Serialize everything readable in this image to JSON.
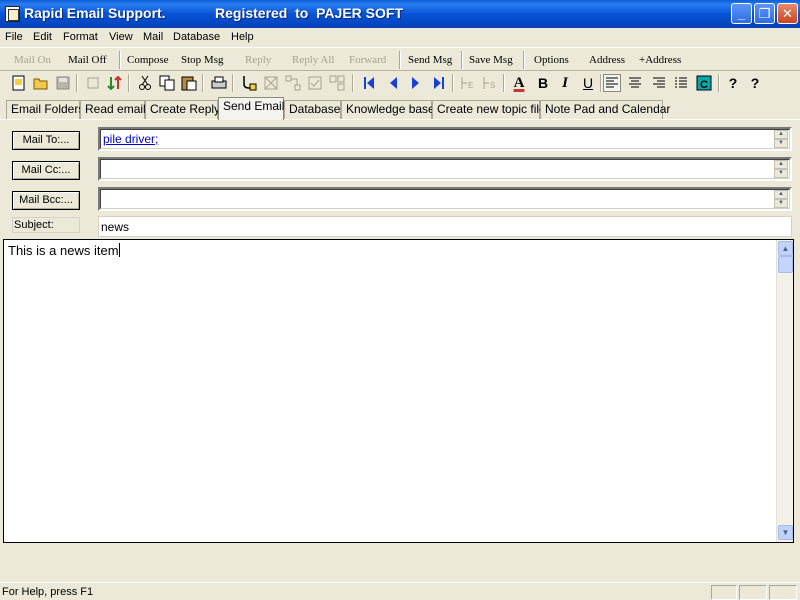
{
  "window": {
    "title": "Rapid Email Support.",
    "registration": "Registered  to  PAJER SOFT",
    "minimize": "_",
    "maximize": "❐",
    "close": "✕"
  },
  "menu": [
    "File",
    "Edit",
    "Format",
    "View",
    "Mail",
    "Database",
    "Help"
  ],
  "text_toolbar": {
    "mail_on": "Mail On",
    "mail_off": "Mail Off",
    "compose": "Compose",
    "stop_msg": "Stop Msg",
    "reply": "Reply",
    "reply_all": "Reply All",
    "forward": "Forward",
    "send_msg": "Send Msg",
    "save_msg": "Save Msg",
    "options": "Options",
    "address": "Address",
    "add_address": "+Address"
  },
  "icon_toolbar": {
    "bold": "B",
    "italic": "I",
    "underline": "U",
    "font_color": "A",
    "help": "?",
    "whats_this": "?"
  },
  "tabs": [
    "Email Folders",
    "Read email",
    "Create Reply",
    "Send Email",
    "Database",
    "Knowledge base",
    "Create new topic file",
    "Note Pad and Calendar"
  ],
  "active_tab": "Send Email",
  "form": {
    "mail_to_label": "Mail To:...",
    "mail_cc_label": "Mail Cc:...",
    "mail_bcc_label": "Mail Bcc:...",
    "to_value": "pile driver;",
    "cc_value": "",
    "bcc_value": "",
    "subject_label": "Subject:",
    "subject_value": "news"
  },
  "body": {
    "text": "This is a news item"
  },
  "status": {
    "help_text": "For Help, press F1"
  },
  "colors": {
    "titlebar": "#0653d6",
    "face": "#ece9d8",
    "link": "#0000cc",
    "nav_arrows": "#1a3fd6"
  }
}
